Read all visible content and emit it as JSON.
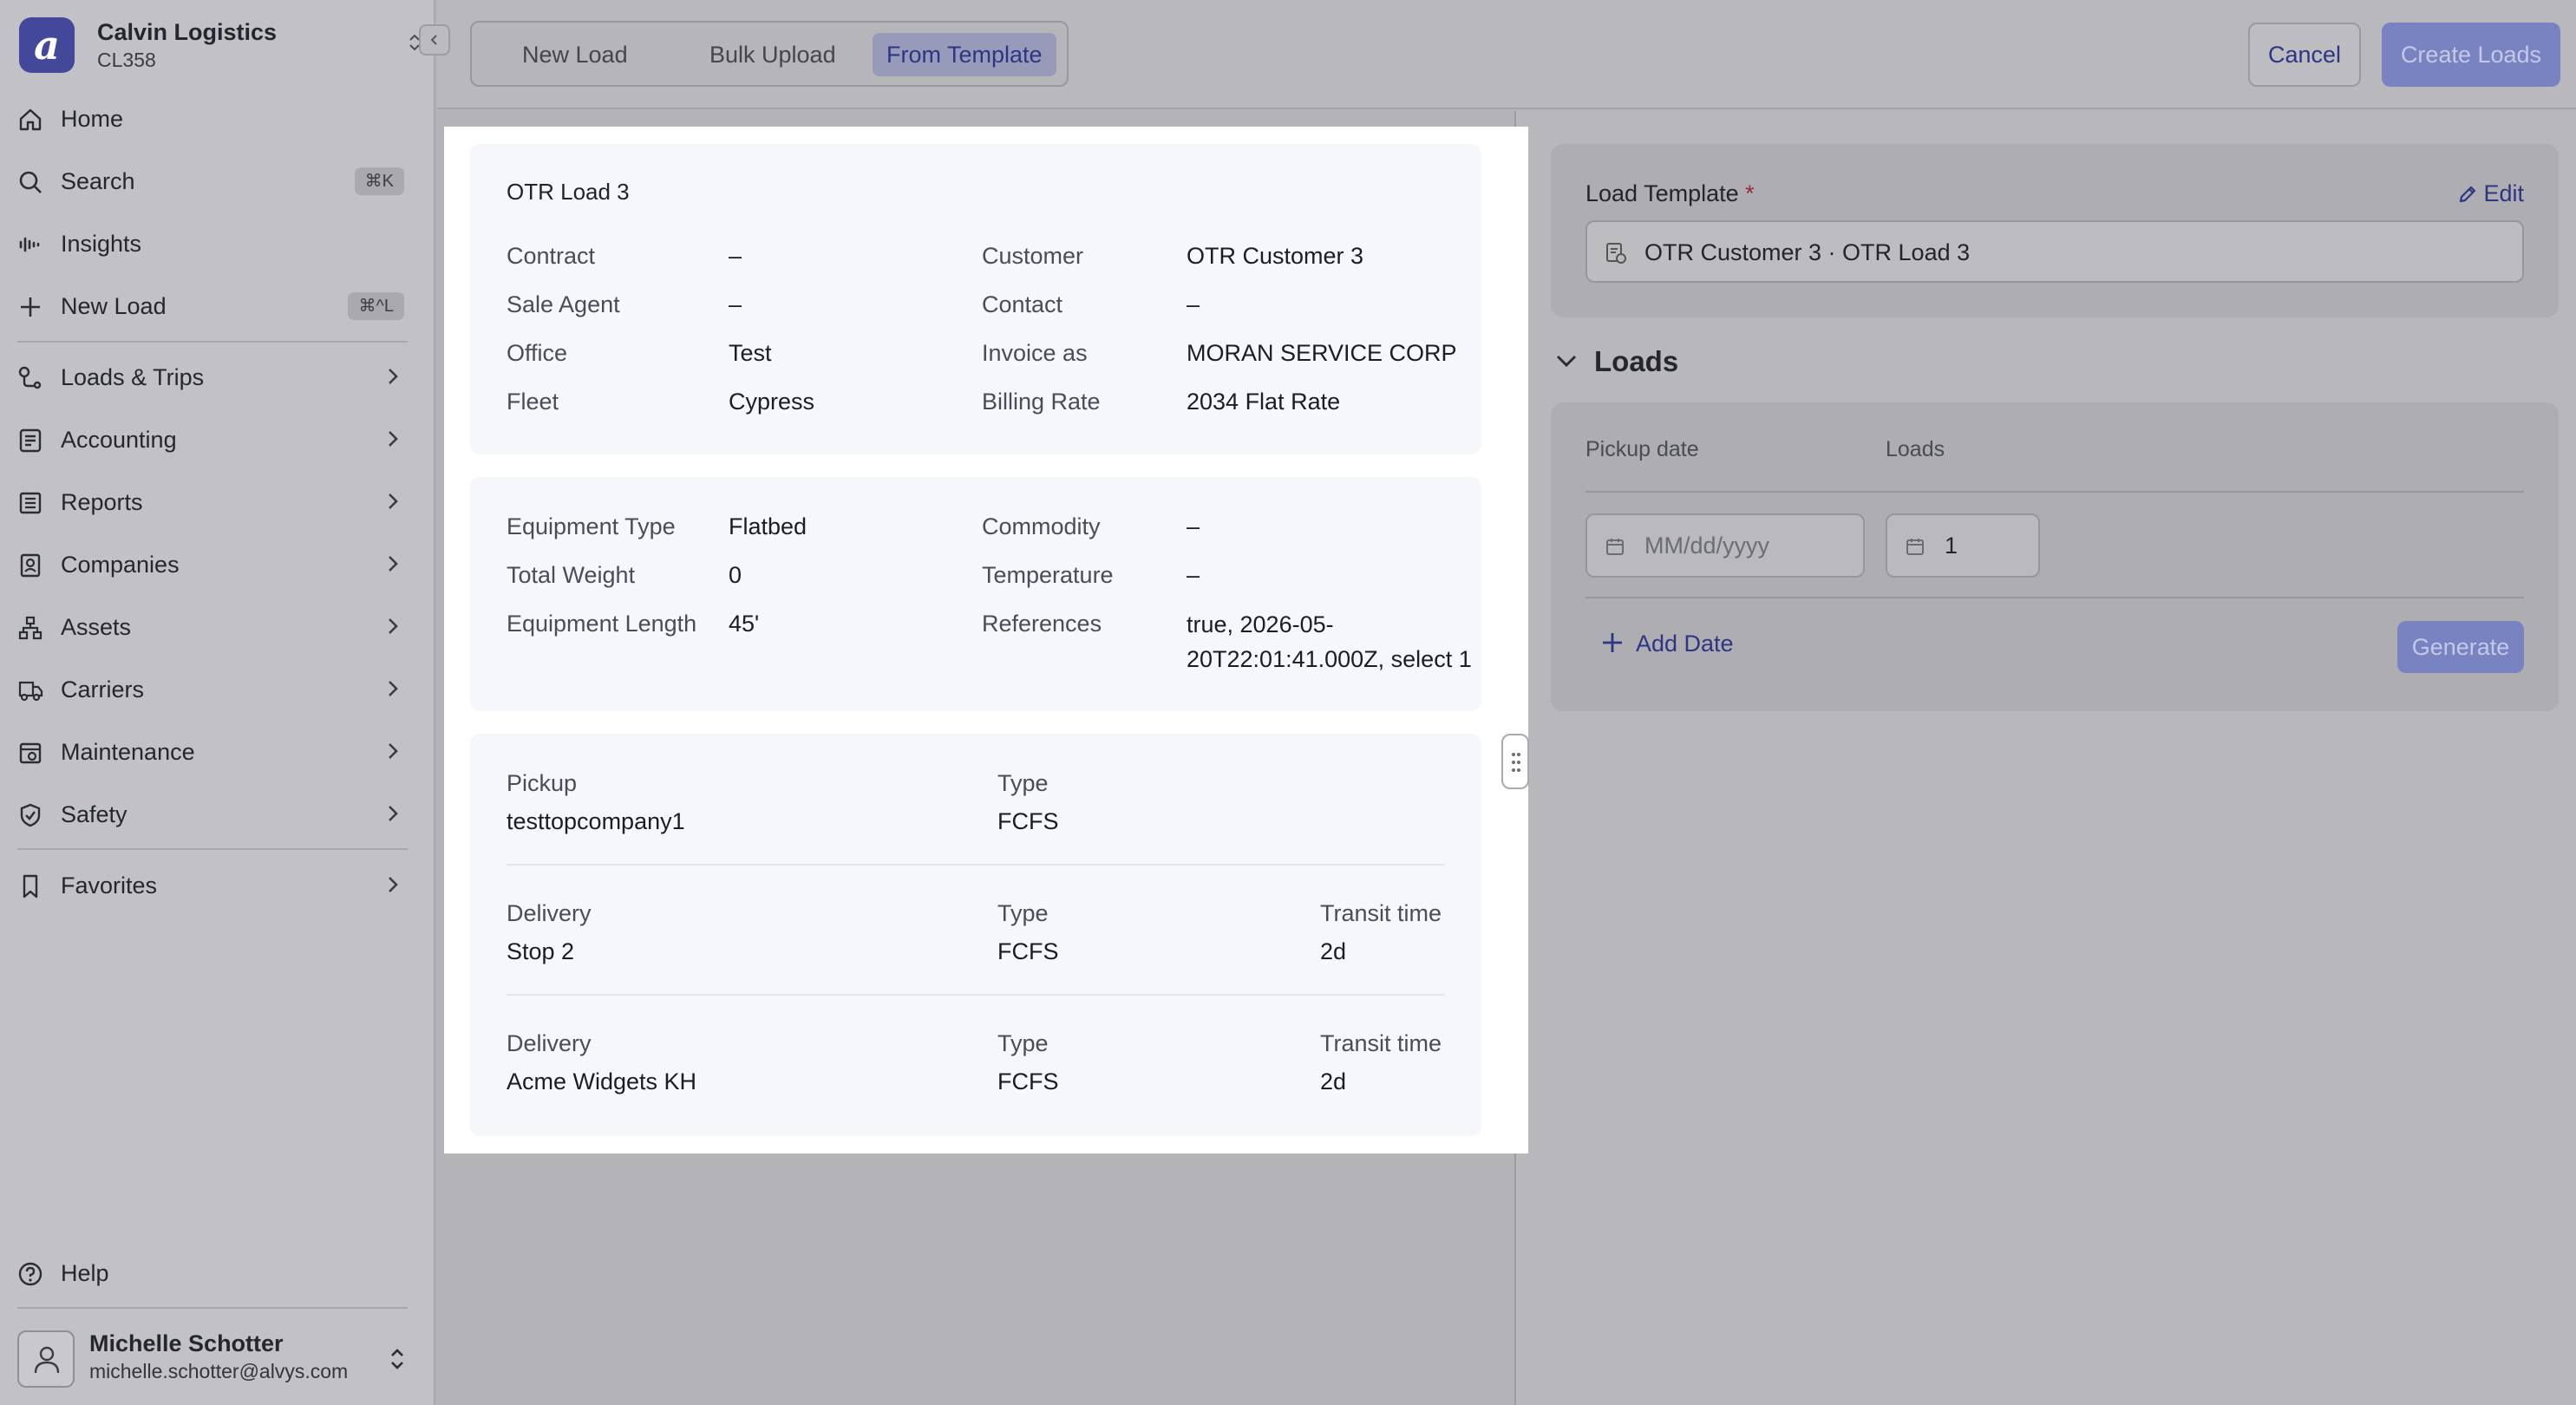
{
  "sidebar": {
    "org": {
      "logo_letter": "a",
      "name": "Calvin Logistics",
      "code": "CL358"
    },
    "items": [
      {
        "label": "Home",
        "icon": "home-icon"
      },
      {
        "label": "Search",
        "icon": "search-icon",
        "shortcut": "⌘K"
      },
      {
        "label": "Insights",
        "icon": "insights-icon"
      },
      {
        "label": "New Load",
        "icon": "plus-icon",
        "shortcut": "⌘^L"
      },
      {
        "label": "Loads & Trips",
        "icon": "route-icon"
      },
      {
        "label": "Accounting",
        "icon": "accounting-icon"
      },
      {
        "label": "Reports",
        "icon": "reports-icon"
      },
      {
        "label": "Companies",
        "icon": "companies-icon"
      },
      {
        "label": "Assets",
        "icon": "assets-icon"
      },
      {
        "label": "Carriers",
        "icon": "truck-icon"
      },
      {
        "label": "Maintenance",
        "icon": "maintenance-icon"
      },
      {
        "label": "Safety",
        "icon": "shield-icon"
      },
      {
        "label": "Favorites",
        "icon": "bookmark-icon"
      }
    ],
    "help_label": "Help",
    "user": {
      "name": "Michelle Schotter",
      "email": "michelle.schotter@alvys.com"
    }
  },
  "header": {
    "tabs": [
      "New Load",
      "Bulk Upload",
      "From Template"
    ],
    "active_tab": "From Template",
    "cancel_label": "Cancel",
    "create_label": "Create Loads"
  },
  "preview": {
    "title": "OTR Load 3",
    "general": {
      "contract_label": "Contract",
      "contract": "–",
      "sale_agent_label": "Sale Agent",
      "sale_agent": "–",
      "office_label": "Office",
      "office": "Test",
      "fleet_label": "Fleet",
      "fleet": "Cypress",
      "customer_label": "Customer",
      "customer": "OTR Customer 3",
      "contact_label": "Contact",
      "contact": "–",
      "invoice_as_label": "Invoice as",
      "invoice_as": "MORAN SERVICE CORP",
      "billing_rate_label": "Billing Rate",
      "billing_rate": "2034 Flat Rate"
    },
    "equipment": {
      "type_label": "Equipment Type",
      "type": "Flatbed",
      "weight_label": "Total Weight",
      "weight": "0",
      "length_label": "Equipment Length",
      "length": "45'",
      "commodity_label": "Commodity",
      "commodity": "–",
      "temperature_label": "Temperature",
      "temperature": "–",
      "references_label": "References",
      "references": "true, 2026-05-20T22:01:41.000Z, select 1"
    },
    "stops": [
      {
        "kind": "Pickup",
        "name": "testtopcompany1",
        "type_label": "Type",
        "type": "FCFS",
        "transit_label": "",
        "transit": ""
      },
      {
        "kind": "Delivery",
        "name": "Stop 2",
        "type_label": "Type",
        "type": "FCFS",
        "transit_label": "Transit time",
        "transit": "2d"
      },
      {
        "kind": "Delivery",
        "name": "Acme Widgets KH",
        "type_label": "Type",
        "type": "FCFS",
        "transit_label": "Transit time",
        "transit": "2d"
      }
    ]
  },
  "template_panel": {
    "label": "Load Template",
    "required_mark": "*",
    "edit_label": "Edit",
    "selected": "OTR Customer 3 · OTR Load 3"
  },
  "loads_panel": {
    "title": "Loads",
    "pickup_col": "Pickup date",
    "loads_col": "Loads",
    "date_placeholder": "MM/dd/yyyy",
    "count": "1",
    "add_date_label": "Add Date",
    "generate_label": "Generate"
  },
  "colors": {
    "accent": "#2e3582",
    "primary_button": "#7a83c2",
    "overlay": "#b4b4b8"
  }
}
